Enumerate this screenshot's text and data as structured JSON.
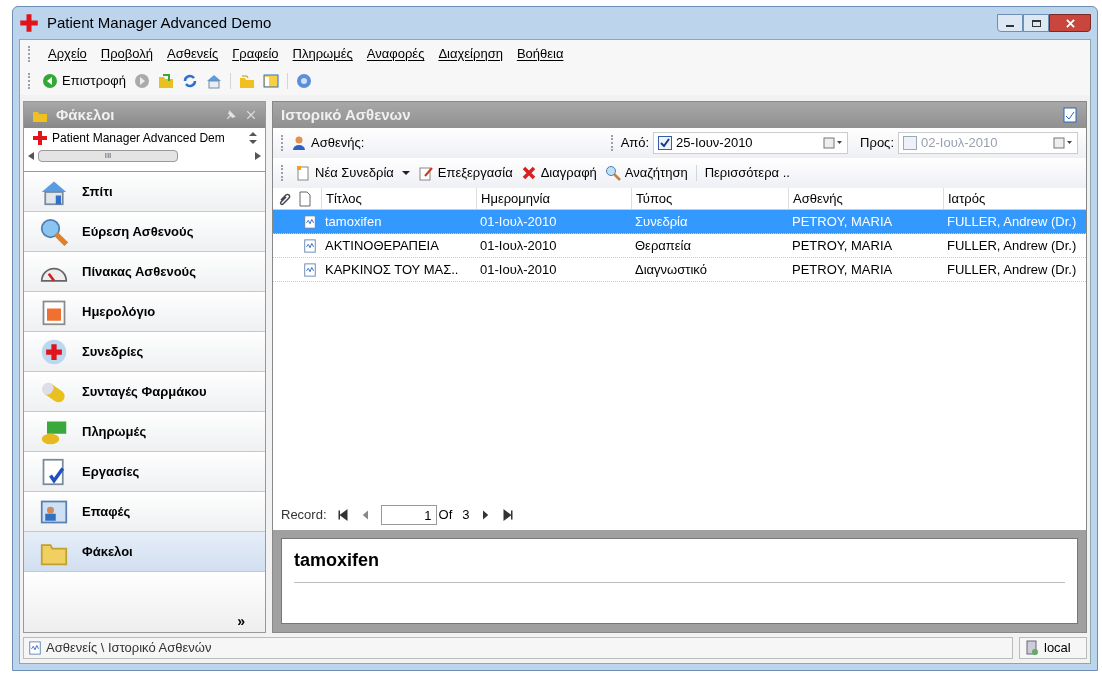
{
  "window": {
    "title": "Patient Manager Advanced Demo"
  },
  "menu": [
    "Αρχείο",
    "Προβολή",
    "Ασθενείς",
    "Γραφείο",
    "Πληρωμές",
    "Αναφορές",
    "Διαχείρηση",
    "Βοήθεια"
  ],
  "toolbar": {
    "back": "Επιστροφή"
  },
  "sidebar": {
    "title": "Φάκελοι",
    "tree": [
      "Patient Manager Advanced Dem"
    ],
    "scroll_label": "III",
    "items": [
      {
        "label": "Σπίτι",
        "selected": false
      },
      {
        "label": "Εύρεση Ασθενούς",
        "selected": false
      },
      {
        "label": "Πίνακας Ασθενούς",
        "selected": false
      },
      {
        "label": "Ημερολόγιο",
        "selected": false
      },
      {
        "label": "Συνεδρίες",
        "selected": false
      },
      {
        "label": "Συνταγές Φαρμάκου",
        "selected": false
      },
      {
        "label": "Πληρωμές",
        "selected": false
      },
      {
        "label": "Εργασίες",
        "selected": false
      },
      {
        "label": "Επαφές",
        "selected": false
      },
      {
        "label": "Φάκελοι",
        "selected": true
      }
    ],
    "more": "»"
  },
  "panel": {
    "title": "Ιστορικό Ασθενων",
    "filter": {
      "patient_label": "Ασθενής:",
      "from_label": "Από:",
      "from_checked": true,
      "from_value": "25-Ιουν-2010",
      "to_label": "Προς:",
      "to_checked": false,
      "to_value": "02-Ιουλ-2010"
    },
    "actions": [
      "Νέα Συνεδρία",
      "Επεξεργασία",
      "Διαγραφή",
      "Αναζήτηση",
      "Περισσότερα .."
    ],
    "table": {
      "columns": [
        "Τίτλος",
        "Ημερομηνία",
        "Τύπος",
        "Ασθενής",
        "Ιατρός"
      ],
      "rows": [
        {
          "cells": [
            "tamoxifen",
            "01-Ιουλ-2010",
            "Συνεδρία",
            "PETROY, MARIA",
            "FULLER, Andrew (Dr.)"
          ],
          "selected": true
        },
        {
          "cells": [
            "ΑΚΤΙΝΟΘΕΡΑΠΕΙΑ",
            "01-Ιουλ-2010",
            "Θεραπεία",
            "PETROY, MARIA",
            "FULLER, Andrew (Dr.)"
          ],
          "selected": false
        },
        {
          "cells": [
            "ΚΑΡΚΙΝΟΣ  ΤΟΥ ΜΑΣ..",
            "01-Ιουλ-2010",
            "Διαγνωστικό",
            "PETROY, MARIA",
            "FULLER, Andrew (Dr.)"
          ],
          "selected": false
        }
      ]
    },
    "navigator": {
      "label": "Record:",
      "value": "1",
      "of": "Of",
      "total": "3"
    },
    "preview": {
      "title": "tamoxifen"
    }
  },
  "status_bar": {
    "path": "Ασθενείς \\ Ιστορικό Ασθενών",
    "server": "local"
  }
}
